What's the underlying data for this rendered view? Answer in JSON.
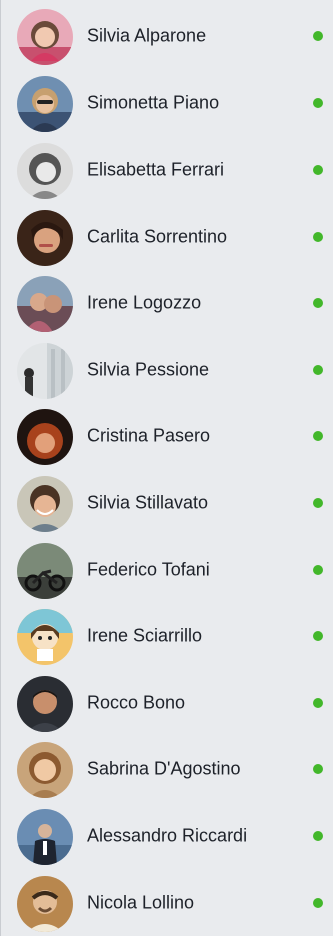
{
  "status_color": "#42b72a",
  "contacts": [
    {
      "name": "Silvia Alparone",
      "online": true,
      "avatar_icon": "person-photo-avatar"
    },
    {
      "name": "Simonetta Piano",
      "online": true,
      "avatar_icon": "person-photo-avatar"
    },
    {
      "name": "Elisabetta Ferrari",
      "online": true,
      "avatar_icon": "person-photo-avatar"
    },
    {
      "name": "Carlita Sorrentino",
      "online": true,
      "avatar_icon": "person-photo-avatar"
    },
    {
      "name": "Irene Logozzo",
      "online": true,
      "avatar_icon": "person-photo-avatar"
    },
    {
      "name": "Silvia Pessione",
      "online": true,
      "avatar_icon": "person-photo-avatar"
    },
    {
      "name": "Cristina Pasero",
      "online": true,
      "avatar_icon": "person-photo-avatar"
    },
    {
      "name": "Silvia Stillavato",
      "online": true,
      "avatar_icon": "person-photo-avatar"
    },
    {
      "name": "Federico Tofani",
      "online": true,
      "avatar_icon": "person-photo-avatar"
    },
    {
      "name": "Irene Sciarrillo",
      "online": true,
      "avatar_icon": "cartoon-avatar"
    },
    {
      "name": "Rocco Bono",
      "online": true,
      "avatar_icon": "person-photo-avatar"
    },
    {
      "name": "Sabrina D'Agostino",
      "online": true,
      "avatar_icon": "person-photo-avatar"
    },
    {
      "name": "Alessandro Riccardi",
      "online": true,
      "avatar_icon": "person-photo-avatar"
    },
    {
      "name": "Nicola Lollino",
      "online": true,
      "avatar_icon": "person-photo-avatar"
    }
  ]
}
